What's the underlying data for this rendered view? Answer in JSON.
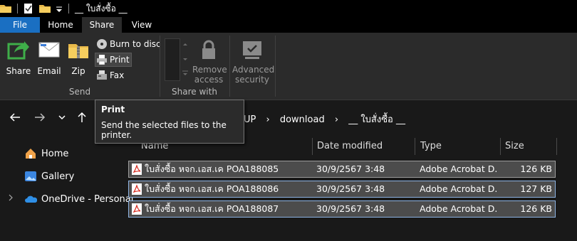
{
  "window": {
    "title": "__ ใบสั่งซื้อ __"
  },
  "ribbon": {
    "tabs": [
      "File",
      "Home",
      "Share",
      "View"
    ],
    "active_tab": "Share",
    "send_group": {
      "label": "Send",
      "share_label": "Share",
      "email_label": "Email",
      "zip_label": "Zip",
      "burn_label": "Burn to disc",
      "print_label": "Print",
      "fax_label": "Fax"
    },
    "share_with_group": {
      "label": "Share with",
      "remove_access_label_1": "Remove",
      "remove_access_label_2": "access"
    },
    "advanced_security": {
      "label_1": "Advanced",
      "label_2": "security"
    }
  },
  "breadcrumb": {
    "partial": "UP",
    "items": [
      "download",
      "__ ใบสั่งซื้อ __"
    ]
  },
  "tooltip": {
    "title": "Print",
    "description_1": "Send the selected files to the",
    "description_2": "printer."
  },
  "sidebar": {
    "items": [
      "Home",
      "Gallery",
      "OneDrive - Personal"
    ]
  },
  "columns": {
    "name": "Name",
    "date": "Date modified",
    "type": "Type",
    "size": "Size"
  },
  "files": [
    {
      "name": "ใบสั่งซื้อ หจก.เอส.เค POA188085",
      "date": "30/9/2567 3:48",
      "type": "Adobe Acrobat D...",
      "size": "126 KB"
    },
    {
      "name": "ใบสั่งซื้อ หจก.เอส.เค POA188086",
      "date": "30/9/2567 3:48",
      "type": "Adobe Acrobat D...",
      "size": "127 KB"
    },
    {
      "name": "ใบสั่งซื้อ หจก.เอส.เค POA188087",
      "date": "30/9/2567 3:48",
      "type": "Adobe Acrobat D...",
      "size": "126 KB"
    }
  ],
  "colors": {
    "file_tab": "#1a6fc2",
    "ribbon_bg": "#2b2b2b",
    "selection": "#4c4c4c",
    "window_bg": "#191919"
  }
}
